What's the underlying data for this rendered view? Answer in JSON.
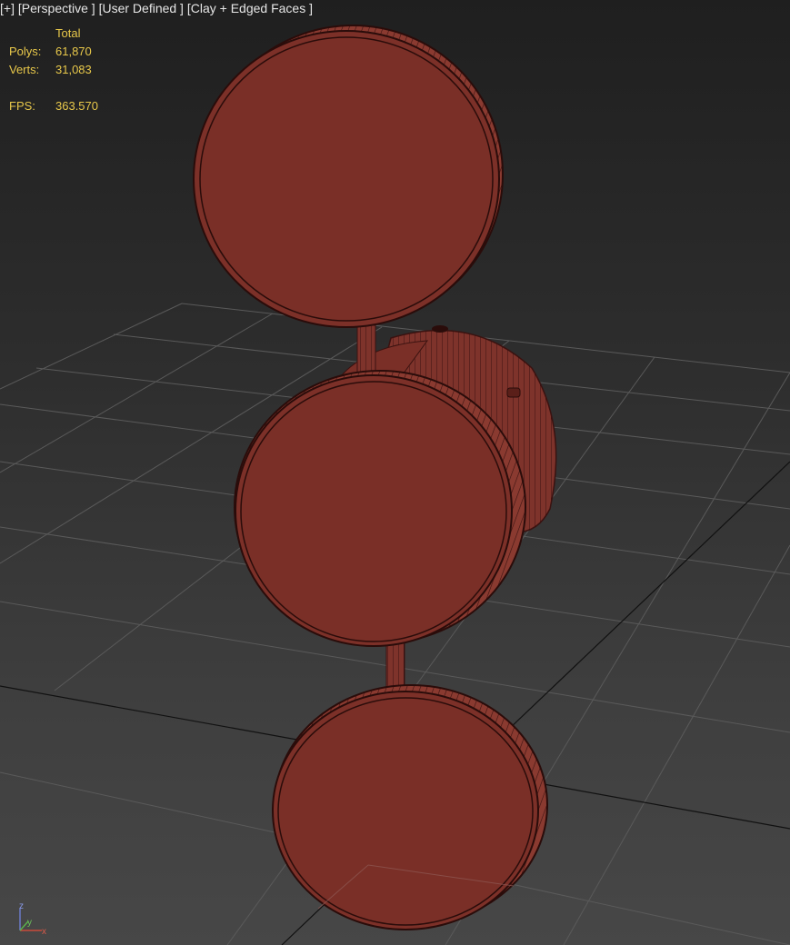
{
  "viewport": {
    "label_plus": "[+]",
    "label_view": "[Perspective ]",
    "label_shading": "[User Defined ]",
    "label_style": "[Clay + Edged Faces ]"
  },
  "stats": {
    "header": "Total",
    "polys_label": "Polys:",
    "polys_value": "61,870",
    "verts_label": "Verts:",
    "verts_value": "31,083",
    "fps_label": "FPS:",
    "fps_value": "363.570"
  },
  "gizmo": {
    "z": "z",
    "y": "y",
    "x": "x"
  },
  "colors": {
    "clay": "#7c3028",
    "clay_side": "#8f3a30",
    "edge": "#3a1210",
    "grid": "#5a5a5a",
    "stats_text": "#e8c84a",
    "label_text": "#e6e6e6"
  }
}
